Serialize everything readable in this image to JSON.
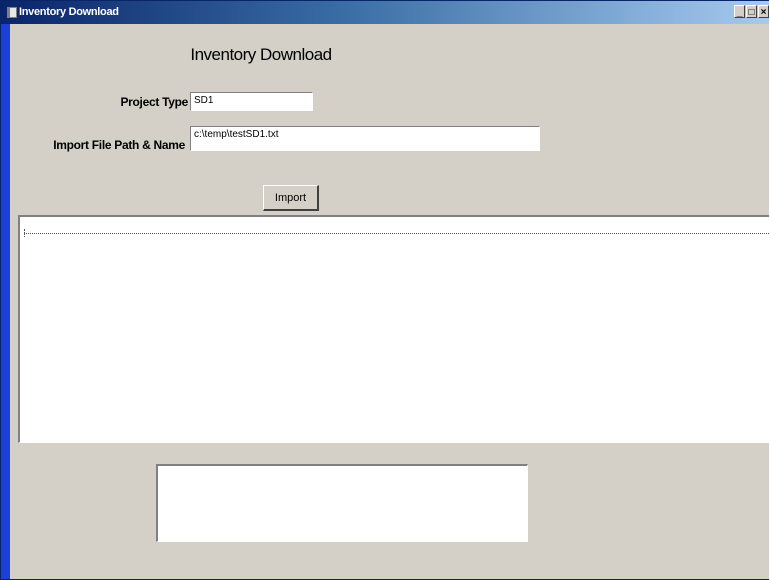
{
  "window": {
    "title": "Inventory Download",
    "minimize_glyph": "_",
    "maximize_glyph": "□",
    "close_glyph": "×"
  },
  "form": {
    "heading": "Inventory Download",
    "project_type": {
      "label": "Project Type",
      "value": "SD1"
    },
    "import_path": {
      "label": "Import File Path & Name",
      "value": "c:\\temp\\testSD1.txt"
    },
    "import_button_label": "Import"
  },
  "output_list": {
    "items": []
  },
  "status_box": {
    "text": ""
  },
  "colors": {
    "title_bar_start": "#0a246a",
    "title_bar_end": "#a6caf0",
    "dialog_face": "#d4d0c8",
    "window_edge": "#1c3fd8"
  },
  "icons": {
    "app": "app-window-icon",
    "minimize": "minimize-icon",
    "maximize": "maximize-icon",
    "close": "close-icon"
  }
}
